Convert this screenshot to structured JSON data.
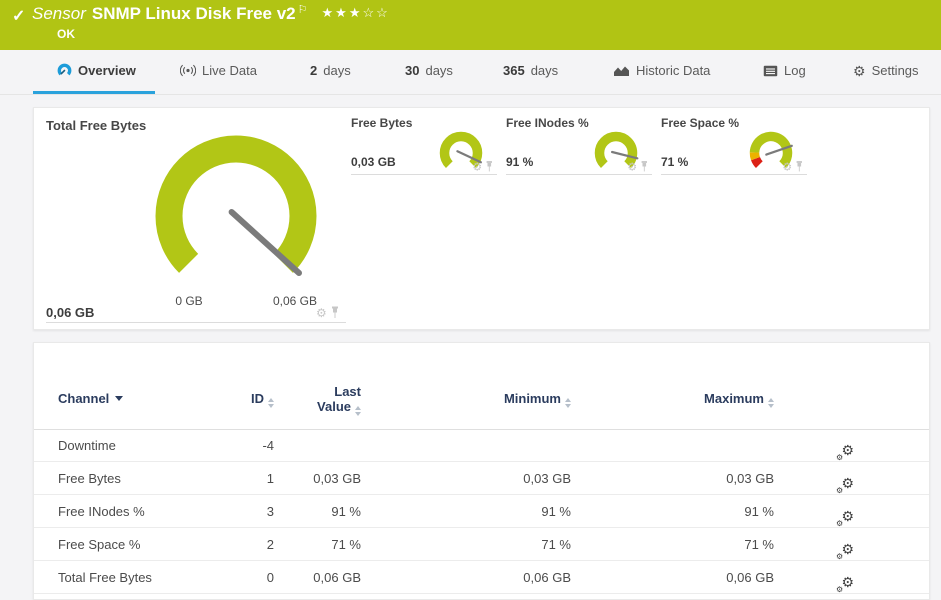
{
  "header": {
    "check_icon": "✓",
    "kind": "Sensor",
    "title": "SNMP Linux Disk Free v2",
    "flag": "⚐",
    "stars": "★★★☆☆",
    "status": "OK"
  },
  "tabs": {
    "overview": "Overview",
    "live": "Live Data",
    "d2_num": "2",
    "d2_label": "days",
    "d30_num": "30",
    "d30_label": "days",
    "d365_num": "365",
    "d365_label": "days",
    "historic": "Historic Data",
    "log": "Log",
    "settings": "Settings"
  },
  "gauges": {
    "primary": {
      "title": "Total Free Bytes",
      "value": "0,06 GB",
      "min_label": "0 GB",
      "max_label": "0,06 GB"
    },
    "small": [
      {
        "title": "Free Bytes",
        "value": "0,03 GB"
      },
      {
        "title": "Free INodes %",
        "value": "91 %"
      },
      {
        "title": "Free Space %",
        "value": "71 %"
      }
    ]
  },
  "table": {
    "headers": {
      "channel": "Channel",
      "id": "ID",
      "last1": "Last",
      "last2": "Value",
      "min": "Minimum",
      "max": "Maximum"
    },
    "rows": [
      {
        "channel": "Downtime",
        "id": "-4",
        "last": "",
        "min": "",
        "max": ""
      },
      {
        "channel": "Free Bytes",
        "id": "1",
        "last": "0,03 GB",
        "min": "0,03 GB",
        "max": "0,03 GB"
      },
      {
        "channel": "Free INodes %",
        "id": "3",
        "last": "91 %",
        "min": "91 %",
        "max": "91 %"
      },
      {
        "channel": "Free Space %",
        "id": "2",
        "last": "71 %",
        "min": "71 %",
        "max": "71 %"
      },
      {
        "channel": "Total Free Bytes",
        "id": "0",
        "last": "0,06 GB",
        "min": "0,06 GB",
        "max": "0,06 GB"
      }
    ]
  },
  "colors": {
    "brand_green": "#b1c414",
    "accent_blue": "#2aa2dc",
    "status_red": "#dc2116",
    "status_orange": "#ecb200",
    "header_navy": "#2b3c5e",
    "needle_gray": "#7b7b7b"
  }
}
